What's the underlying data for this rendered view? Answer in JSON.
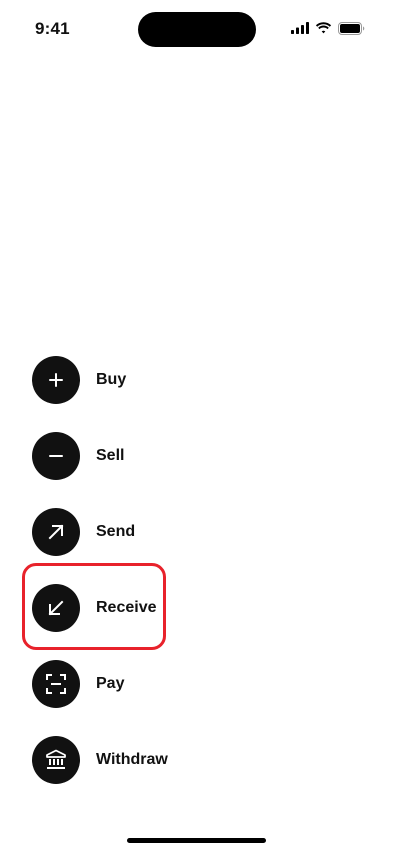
{
  "status_bar": {
    "time": "9:41",
    "icons": [
      "cellular-signal-icon",
      "wifi-icon",
      "battery-icon"
    ]
  },
  "actions": [
    {
      "label": "Buy",
      "icon": "plus-icon"
    },
    {
      "label": "Sell",
      "icon": "minus-icon"
    },
    {
      "label": "Send",
      "icon": "arrow-up-right-icon"
    },
    {
      "label": "Receive",
      "icon": "arrow-down-left-icon"
    },
    {
      "label": "Pay",
      "icon": "scan-frame-icon"
    },
    {
      "label": "Withdraw",
      "icon": "bank-icon"
    }
  ],
  "highlight": {
    "target": "Receive",
    "color": "#e8222b"
  },
  "colors": {
    "icon_background": "#111111",
    "icon_foreground": "#ffffff",
    "text": "#111111",
    "background": "#ffffff"
  }
}
